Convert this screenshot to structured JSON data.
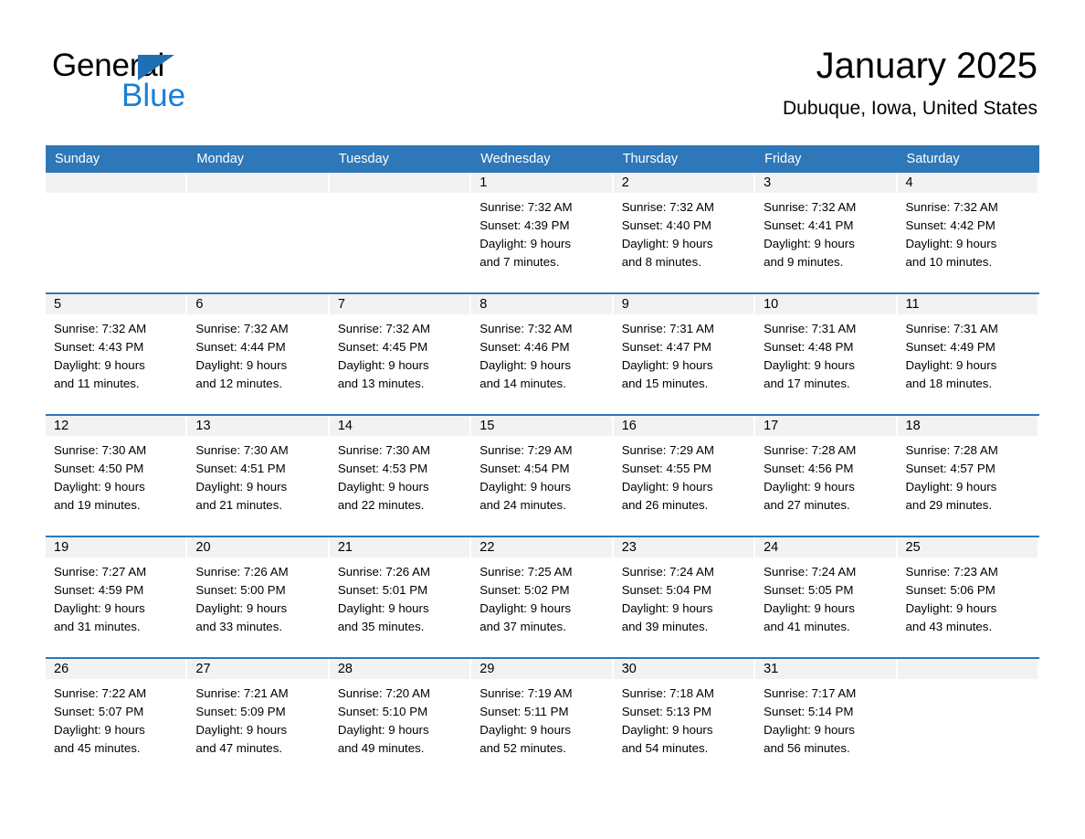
{
  "brand": {
    "name_part1": "General",
    "name_part2": "Blue",
    "accent_color": "#1b7fd4",
    "header_color": "#2e77b8"
  },
  "header": {
    "title": "January 2025",
    "subtitle": "Dubuque, Iowa, United States"
  },
  "weekdays": [
    "Sunday",
    "Monday",
    "Tuesday",
    "Wednesday",
    "Thursday",
    "Friday",
    "Saturday"
  ],
  "weeks": [
    {
      "days": [
        {
          "num": "",
          "lines": []
        },
        {
          "num": "",
          "lines": []
        },
        {
          "num": "",
          "lines": []
        },
        {
          "num": "1",
          "lines": [
            "Sunrise: 7:32 AM",
            "Sunset: 4:39 PM",
            "Daylight: 9 hours",
            "and 7 minutes."
          ]
        },
        {
          "num": "2",
          "lines": [
            "Sunrise: 7:32 AM",
            "Sunset: 4:40 PM",
            "Daylight: 9 hours",
            "and 8 minutes."
          ]
        },
        {
          "num": "3",
          "lines": [
            "Sunrise: 7:32 AM",
            "Sunset: 4:41 PM",
            "Daylight: 9 hours",
            "and 9 minutes."
          ]
        },
        {
          "num": "4",
          "lines": [
            "Sunrise: 7:32 AM",
            "Sunset: 4:42 PM",
            "Daylight: 9 hours",
            "and 10 minutes."
          ]
        }
      ]
    },
    {
      "days": [
        {
          "num": "5",
          "lines": [
            "Sunrise: 7:32 AM",
            "Sunset: 4:43 PM",
            "Daylight: 9 hours",
            "and 11 minutes."
          ]
        },
        {
          "num": "6",
          "lines": [
            "Sunrise: 7:32 AM",
            "Sunset: 4:44 PM",
            "Daylight: 9 hours",
            "and 12 minutes."
          ]
        },
        {
          "num": "7",
          "lines": [
            "Sunrise: 7:32 AM",
            "Sunset: 4:45 PM",
            "Daylight: 9 hours",
            "and 13 minutes."
          ]
        },
        {
          "num": "8",
          "lines": [
            "Sunrise: 7:32 AM",
            "Sunset: 4:46 PM",
            "Daylight: 9 hours",
            "and 14 minutes."
          ]
        },
        {
          "num": "9",
          "lines": [
            "Sunrise: 7:31 AM",
            "Sunset: 4:47 PM",
            "Daylight: 9 hours",
            "and 15 minutes."
          ]
        },
        {
          "num": "10",
          "lines": [
            "Sunrise: 7:31 AM",
            "Sunset: 4:48 PM",
            "Daylight: 9 hours",
            "and 17 minutes."
          ]
        },
        {
          "num": "11",
          "lines": [
            "Sunrise: 7:31 AM",
            "Sunset: 4:49 PM",
            "Daylight: 9 hours",
            "and 18 minutes."
          ]
        }
      ]
    },
    {
      "days": [
        {
          "num": "12",
          "lines": [
            "Sunrise: 7:30 AM",
            "Sunset: 4:50 PM",
            "Daylight: 9 hours",
            "and 19 minutes."
          ]
        },
        {
          "num": "13",
          "lines": [
            "Sunrise: 7:30 AM",
            "Sunset: 4:51 PM",
            "Daylight: 9 hours",
            "and 21 minutes."
          ]
        },
        {
          "num": "14",
          "lines": [
            "Sunrise: 7:30 AM",
            "Sunset: 4:53 PM",
            "Daylight: 9 hours",
            "and 22 minutes."
          ]
        },
        {
          "num": "15",
          "lines": [
            "Sunrise: 7:29 AM",
            "Sunset: 4:54 PM",
            "Daylight: 9 hours",
            "and 24 minutes."
          ]
        },
        {
          "num": "16",
          "lines": [
            "Sunrise: 7:29 AM",
            "Sunset: 4:55 PM",
            "Daylight: 9 hours",
            "and 26 minutes."
          ]
        },
        {
          "num": "17",
          "lines": [
            "Sunrise: 7:28 AM",
            "Sunset: 4:56 PM",
            "Daylight: 9 hours",
            "and 27 minutes."
          ]
        },
        {
          "num": "18",
          "lines": [
            "Sunrise: 7:28 AM",
            "Sunset: 4:57 PM",
            "Daylight: 9 hours",
            "and 29 minutes."
          ]
        }
      ]
    },
    {
      "days": [
        {
          "num": "19",
          "lines": [
            "Sunrise: 7:27 AM",
            "Sunset: 4:59 PM",
            "Daylight: 9 hours",
            "and 31 minutes."
          ]
        },
        {
          "num": "20",
          "lines": [
            "Sunrise: 7:26 AM",
            "Sunset: 5:00 PM",
            "Daylight: 9 hours",
            "and 33 minutes."
          ]
        },
        {
          "num": "21",
          "lines": [
            "Sunrise: 7:26 AM",
            "Sunset: 5:01 PM",
            "Daylight: 9 hours",
            "and 35 minutes."
          ]
        },
        {
          "num": "22",
          "lines": [
            "Sunrise: 7:25 AM",
            "Sunset: 5:02 PM",
            "Daylight: 9 hours",
            "and 37 minutes."
          ]
        },
        {
          "num": "23",
          "lines": [
            "Sunrise: 7:24 AM",
            "Sunset: 5:04 PM",
            "Daylight: 9 hours",
            "and 39 minutes."
          ]
        },
        {
          "num": "24",
          "lines": [
            "Sunrise: 7:24 AM",
            "Sunset: 5:05 PM",
            "Daylight: 9 hours",
            "and 41 minutes."
          ]
        },
        {
          "num": "25",
          "lines": [
            "Sunrise: 7:23 AM",
            "Sunset: 5:06 PM",
            "Daylight: 9 hours",
            "and 43 minutes."
          ]
        }
      ]
    },
    {
      "days": [
        {
          "num": "26",
          "lines": [
            "Sunrise: 7:22 AM",
            "Sunset: 5:07 PM",
            "Daylight: 9 hours",
            "and 45 minutes."
          ]
        },
        {
          "num": "27",
          "lines": [
            "Sunrise: 7:21 AM",
            "Sunset: 5:09 PM",
            "Daylight: 9 hours",
            "and 47 minutes."
          ]
        },
        {
          "num": "28",
          "lines": [
            "Sunrise: 7:20 AM",
            "Sunset: 5:10 PM",
            "Daylight: 9 hours",
            "and 49 minutes."
          ]
        },
        {
          "num": "29",
          "lines": [
            "Sunrise: 7:19 AM",
            "Sunset: 5:11 PM",
            "Daylight: 9 hours",
            "and 52 minutes."
          ]
        },
        {
          "num": "30",
          "lines": [
            "Sunrise: 7:18 AM",
            "Sunset: 5:13 PM",
            "Daylight: 9 hours",
            "and 54 minutes."
          ]
        },
        {
          "num": "31",
          "lines": [
            "Sunrise: 7:17 AM",
            "Sunset: 5:14 PM",
            "Daylight: 9 hours",
            "and 56 minutes."
          ]
        },
        {
          "num": "",
          "lines": []
        }
      ]
    }
  ]
}
